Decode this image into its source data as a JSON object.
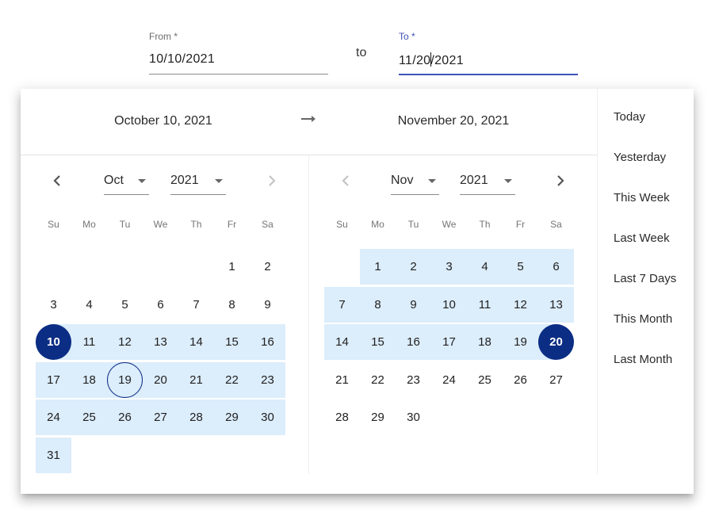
{
  "inputs": {
    "from": {
      "label": "From *",
      "value": "10/10/2021"
    },
    "separator": "to",
    "to": {
      "label": "To *",
      "value_before_caret": "11/20",
      "value_after_caret": "/2021",
      "value": "11/20/2021"
    }
  },
  "header": {
    "start_date": "October 10, 2021",
    "arrow_icon": "arrow-right-icon",
    "end_date": "November 20, 2021"
  },
  "weekdays": [
    "Su",
    "Mo",
    "Tu",
    "We",
    "Th",
    "Fr",
    "Sa"
  ],
  "months": [
    {
      "id": "oct",
      "month_select": "Oct",
      "year_select": "2021",
      "prev_enabled": true,
      "next_enabled": false,
      "first_weekday": 5,
      "days_in_month": 31,
      "range_start_day": 10,
      "range_end_day": 31,
      "endpoint_days": [
        10
      ],
      "today_day": 19
    },
    {
      "id": "nov",
      "month_select": "Nov",
      "year_select": "2021",
      "prev_enabled": false,
      "next_enabled": true,
      "first_weekday": 1,
      "days_in_month": 30,
      "range_start_day": 1,
      "range_end_day": 20,
      "endpoint_days": [
        20
      ],
      "today_day": null
    }
  ],
  "presets": [
    "Today",
    "Yesterday",
    "This Week",
    "Last Week",
    "Last 7 Days",
    "This Month",
    "Last Month"
  ],
  "colors": {
    "accent": "#0b2d84",
    "range_fill": "#dcedfb",
    "focus_underline": "#3f51b5"
  }
}
